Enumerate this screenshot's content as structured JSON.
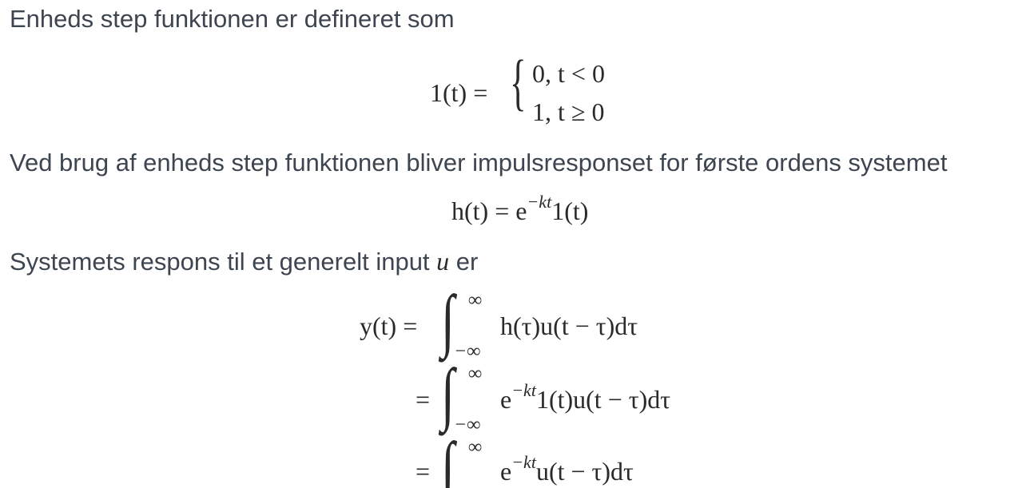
{
  "paragraphs": {
    "p1": "Enheds step funktionen er defineret som",
    "p2": "Ved brug af enheds step funktionen bliver impulsresponset for første ordens systemet",
    "p3_prefix": "Systemets respons til et generelt input",
    "p3_var": "u",
    "p3_suffix": "er"
  },
  "eq_step": {
    "lhs": "1(t) =",
    "case1": "0, t < 0",
    "case2": "1, t ≥ 0"
  },
  "eq_impulse": {
    "lhs": "h(t) = e",
    "exp": "−kt",
    "rhs": "1(t)"
  },
  "eq_response": {
    "lhs": "y(t) =",
    "rows": [
      {
        "eq": "",
        "upper": "∞",
        "lower": "−∞",
        "body_a": "h(τ)u(t − τ)dτ",
        "exp": "",
        "body_b": ""
      },
      {
        "eq": "=",
        "upper": "∞",
        "lower": "−∞",
        "body_a": "e",
        "exp": "−kt",
        "body_b": "1(t)u(t − τ)dτ"
      },
      {
        "eq": "=",
        "upper": "∞",
        "lower": "",
        "body_a": "e",
        "exp": "−kt",
        "body_b": "u(t − τ)dτ"
      }
    ]
  }
}
